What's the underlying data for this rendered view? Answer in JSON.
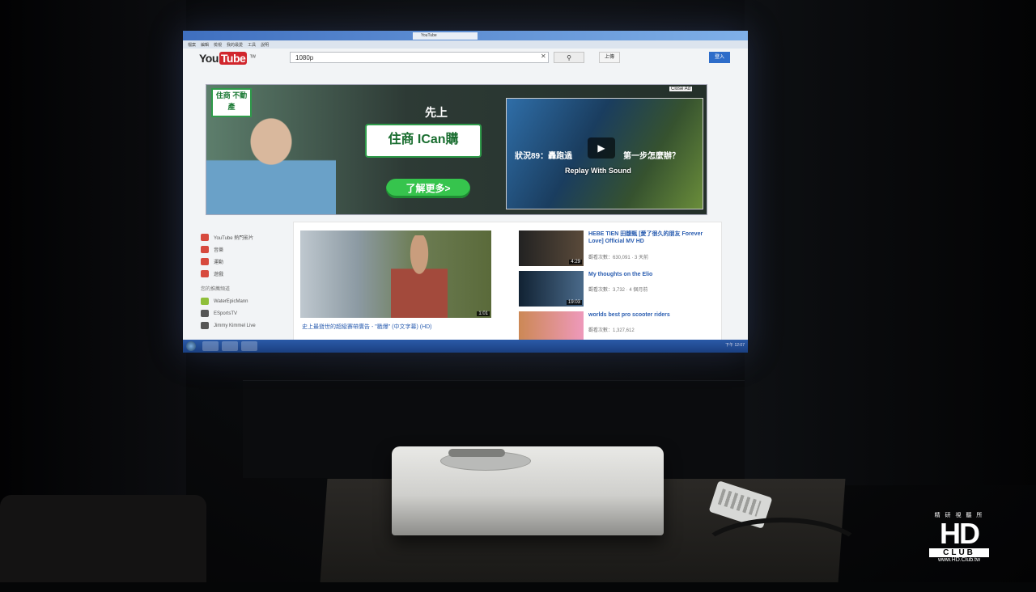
{
  "browser": {
    "tab_title": "YouTube",
    "menu": [
      "檔案",
      "編輯",
      "檢視",
      "我的最愛",
      "工具",
      "說明"
    ]
  },
  "youtube": {
    "logo_text_1": "You",
    "logo_text_2": "Tube",
    "logo_region": "TW",
    "search_value": "1080p",
    "clear_glyph": "✕",
    "search_glyph": "⚲",
    "upload_label": "上傳",
    "signin_label": "登入"
  },
  "ad": {
    "badge": "住商 不動產",
    "slogan": "先上",
    "ican": "住商 ICan購",
    "cta": "了解更多>",
    "close_ad": "Close Ad",
    "video_caption_1": "狀況89：轟跑過",
    "video_caption_2": "第一步怎麼辦？",
    "video_overlay": "Replay With Sound",
    "play_glyph": "▶"
  },
  "sidebar": {
    "items": [
      {
        "label": "YouTube 熱門影片",
        "icon": "youtube-icon"
      },
      {
        "label": "音樂",
        "icon": "music-icon"
      },
      {
        "label": "運動",
        "icon": "sports-icon"
      },
      {
        "label": "遊戲",
        "icon": "games-icon"
      }
    ],
    "section": "您的推薦頻道",
    "channels": [
      {
        "label": "WaterEpicMann",
        "icon": "channel-icon"
      },
      {
        "label": "ESportsTV",
        "icon": "channel-icon"
      },
      {
        "label": "Jimmy Kimmel Live",
        "icon": "channel-icon"
      }
    ]
  },
  "feed": {
    "main_title": "史上最聳世的超級賽帶廣告 - \"戳爆\" (中文字幕) (HD)",
    "main_duration": "1:01",
    "related": [
      {
        "title": "HEBE TIEN 田馥甄 [愛了很久的朋友 Forever Love] Official MV HD",
        "meta": "觀看次數：630,091 · 3 天前",
        "duration": "4:29"
      },
      {
        "title": "My thoughts on the Elio",
        "meta": "觀看次數：3,732 · 4 個月前",
        "duration": "19:03"
      },
      {
        "title": "worlds best pro scooter riders",
        "meta": "觀看次數：1,327,612",
        "duration": ""
      }
    ]
  },
  "taskbar": {
    "tray_time": "下午 12:07"
  },
  "watermark": {
    "top": "精 研 視 聽 所",
    "hd": "HD",
    "club": "CLUB",
    "url": "www.HD.Club.tw"
  }
}
